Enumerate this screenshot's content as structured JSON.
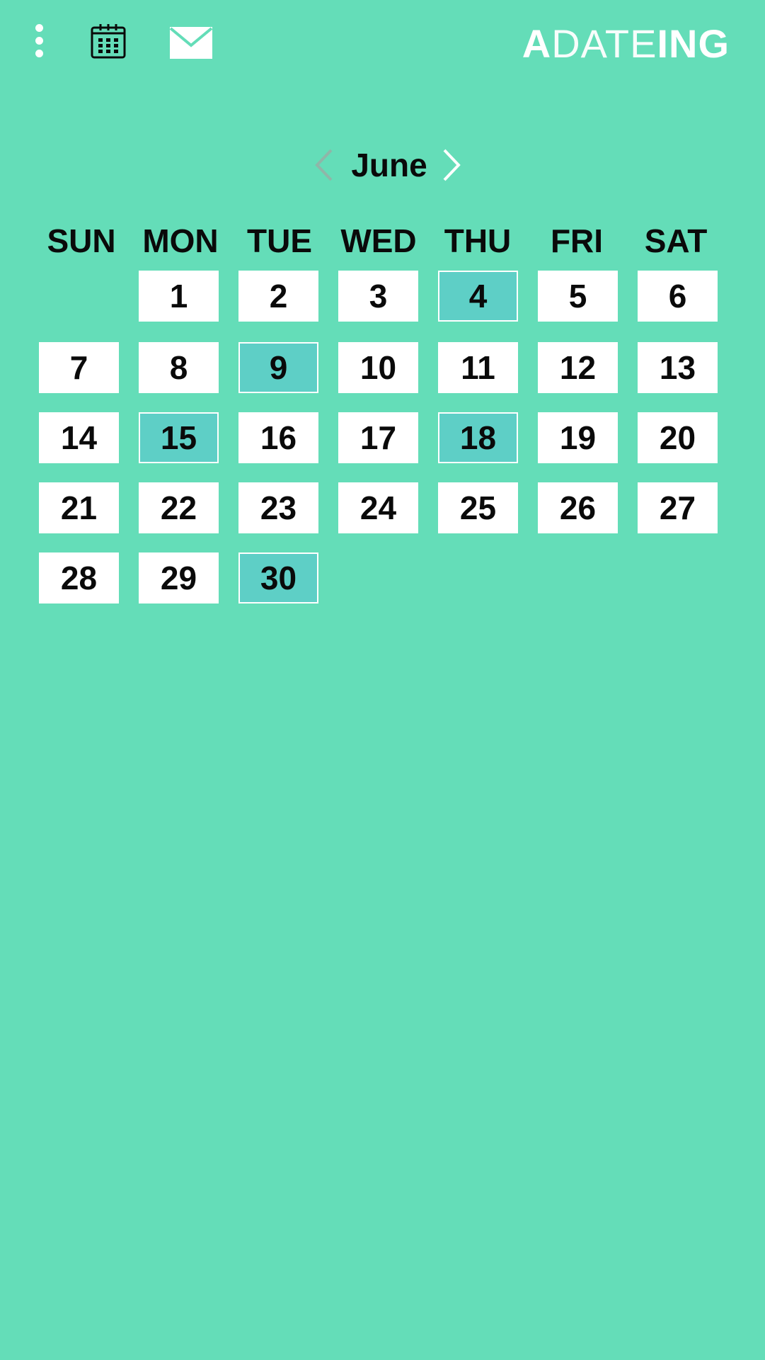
{
  "header": {
    "logo": {
      "part1": "A",
      "part2": "DATE",
      "part3": "ING"
    },
    "icons": {
      "menu": "more-vertical-icon",
      "calendar": "calendar-icon",
      "mail": "mail-icon"
    }
  },
  "calendar": {
    "month": "June",
    "weekdays": [
      "SUN",
      "MON",
      "TUE",
      "WED",
      "THU",
      "FRI",
      "SAT"
    ],
    "start_weekday_index": 1,
    "days_in_month": 30,
    "highlighted_days": [
      4,
      9,
      15,
      18,
      30
    ]
  },
  "colors": {
    "background": "#64ddb8",
    "highlight": "#5ecfc6",
    "cell": "#ffffff",
    "text": "#0a0a0a"
  }
}
